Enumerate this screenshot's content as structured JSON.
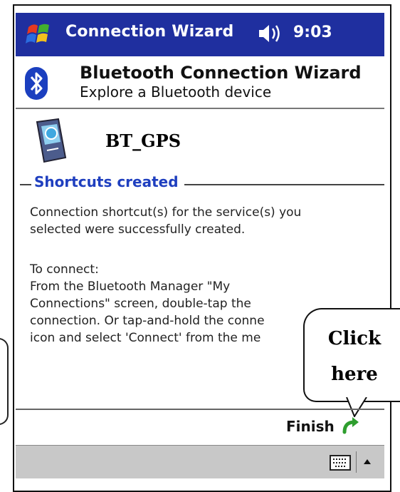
{
  "titlebar": {
    "title": "Connection Wizard",
    "time": "9:03",
    "icons": [
      "start-flag-icon",
      "speaker-icon"
    ]
  },
  "header": {
    "title": "Bluetooth Connection Wizard",
    "subtitle": "Explore a Bluetooth device",
    "icon": "bluetooth-icon"
  },
  "device": {
    "name": "BT_GPS",
    "icon": "device-gps-icon"
  },
  "section": {
    "title": "Shortcuts created"
  },
  "body": {
    "lines": [
      "Connection shortcut(s) for the service(s) you",
      "selected were successfully created.",
      "To connect:",
      "From the Bluetooth Manager \"My",
      "Connections\" screen, double-tap the",
      "connection. Or tap-and-hold the conne",
      "icon and select 'Connect' from the me"
    ]
  },
  "callout": {
    "line1": "Click",
    "line2": "here"
  },
  "footer": {
    "finish_label": "Finish",
    "icons": [
      "finish-arrow-icon",
      "keyboard-icon",
      "sip-up-arrow-icon"
    ]
  },
  "colors": {
    "titlebar": "#1f2f9f",
    "section_title": "#1f3fbf",
    "bottombar": "#c8c8c8",
    "finish_arrow": "#2e9e2e"
  }
}
